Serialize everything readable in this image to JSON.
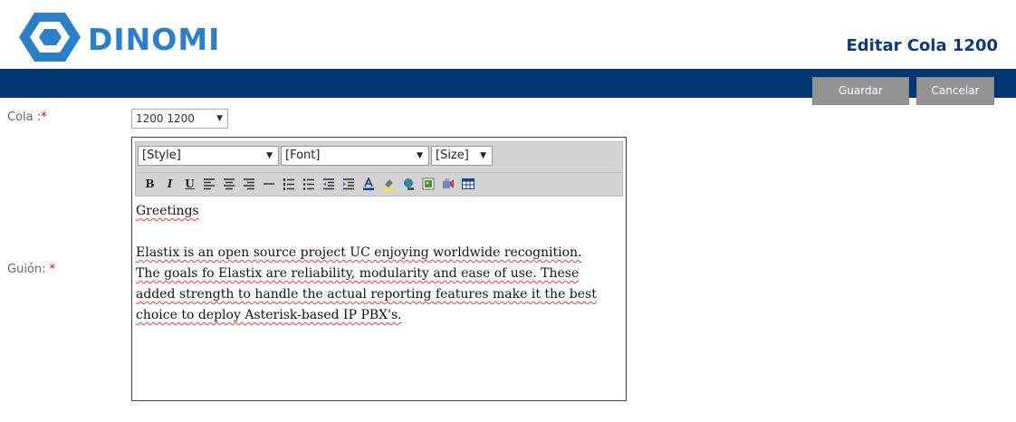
{
  "header": {
    "brand": "DINOMI",
    "page_title": "Editar Cola 1200"
  },
  "actions": {
    "save_label": "Guardar",
    "cancel_label": "Cancelar"
  },
  "form": {
    "cola_label": "Cola :",
    "cola_value": "1200 1200",
    "guion_label": "Guión:",
    "required_mark": "*"
  },
  "editor": {
    "style_select": "[Style]",
    "font_select": "[Font]",
    "size_select": "[Size]",
    "toolbar_buttons": [
      "B",
      "I",
      "U"
    ],
    "content": {
      "greeting": "Greetings",
      "lines": [
        "Elastix is an open source project UC enjoying worldwide recognition.",
        "The goals fo Elastix are reliability, modularity and ease of use. These",
        "added strength to handle the actual reporting features make it the best",
        "choice to deploy Asterisk-based IP PBX's."
      ]
    }
  },
  "colors": {
    "brand_blue": "#2c7fc6",
    "header_bar": "#003772",
    "title": "#0d3a75",
    "button_gray": "#949494",
    "required_red": "#e00000"
  }
}
